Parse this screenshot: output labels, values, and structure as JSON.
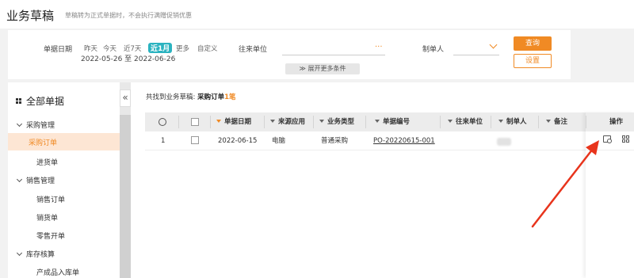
{
  "header": {
    "title": "业务草稿",
    "subtitle": "草稿转为正式单据时，不会执行满赠促销优惠"
  },
  "filter": {
    "date_label": "单据日期",
    "date_options": [
      "昨天",
      "今天",
      "近7天",
      "近1月",
      "更多",
      "自定义"
    ],
    "active_option": "近1月",
    "date_range": "2022-05-26 至 2022-06-26",
    "partner_label": "往来单位",
    "partner_value": "",
    "creator_label": "制单人",
    "creator_value": "",
    "query_button": "查询",
    "settings_button": "设置",
    "expand_label": "展开更多条件"
  },
  "sidebar": {
    "title": "全部单据",
    "groups": [
      {
        "label": "采购管理",
        "items": [
          "采购订单",
          "进货单"
        ]
      },
      {
        "label": "销售管理",
        "items": [
          "销售订单",
          "销货单",
          "零售开单"
        ]
      },
      {
        "label": "库存核算",
        "items": [
          "产成品入库单"
        ]
      }
    ],
    "active_item": "采购订单",
    "collapse_icon": "«"
  },
  "result": {
    "prefix": "共找到业务草稿: ",
    "type": "采购订单",
    "count": "1笔"
  },
  "table": {
    "columns": [
      "",
      "",
      "单据日期",
      "来源应用",
      "业务类型",
      "单据编号",
      "往来单位",
      "制单人",
      "备注",
      "操作"
    ],
    "rows": [
      {
        "index": "1",
        "date": "2022-06-15",
        "source": "电脑",
        "biz_type": "普通采购",
        "number": "PO-20220615-001",
        "partner": "",
        "creator": "",
        "remark": ""
      }
    ]
  },
  "colors": {
    "accent": "#f08a24",
    "active_date": "#2bb3c0",
    "arrow": "#e8341c"
  }
}
